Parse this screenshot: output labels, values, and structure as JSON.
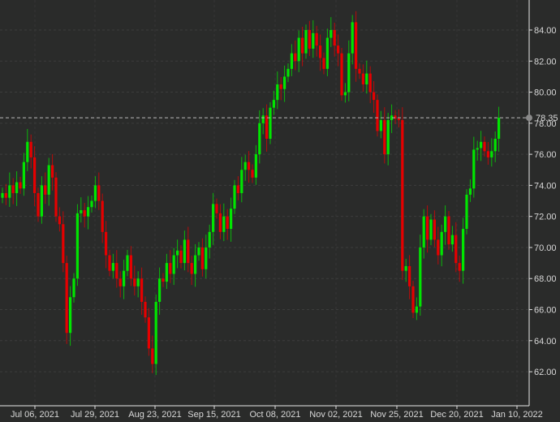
{
  "chart_data": {
    "type": "candlestick",
    "title": "",
    "xlabel": "",
    "ylabel": "",
    "ylim": [
      61,
      85.5
    ],
    "yticks": [
      62,
      64,
      66,
      68,
      70,
      72,
      74,
      76,
      78,
      80,
      82,
      84
    ],
    "ytick_labels": [
      "62.00",
      "64.00",
      "66.00",
      "68.00",
      "70.00",
      "72.00",
      "74.00",
      "76.00",
      "78.00",
      "80.00",
      "82.00",
      "84.00"
    ],
    "xtick_labels": [
      "Jul 06, 2021",
      "Jul 29, 2021",
      "Aug 23, 2021",
      "Sep 15, 2021",
      "Oct 08, 2021",
      "Nov 02, 2021",
      "Nov 25, 2021",
      "Dec 20, 2021",
      "Jan 10, 2022"
    ],
    "xtick_index": [
      9,
      26,
      43,
      59,
      76,
      93,
      110,
      127,
      144
    ],
    "last_price": 78.35,
    "last_price_label": "78.35",
    "up_color": "#00e600",
    "down_color": "#e60000",
    "closes": [
      73.5,
      73.2,
      74,
      73.5,
      74.2,
      73.8,
      75.5,
      76.8,
      75.8,
      73.5,
      72,
      74,
      73.4,
      75.3,
      74.5,
      72,
      71.5,
      69,
      64.5,
      66.8,
      68,
      72.2,
      72.4,
      72,
      72.6,
      73,
      74,
      73,
      71,
      69.5,
      68.5,
      69,
      68,
      67.5,
      68.5,
      69.5,
      68,
      67.5,
      68,
      66.5,
      65.5,
      63.5,
      62.5,
      66.5,
      68,
      67.8,
      69,
      68.3,
      69.5,
      69.8,
      69,
      70.5,
      69,
      68.3,
      69.5,
      70,
      68.6,
      70,
      71,
      72.8,
      72.2,
      71,
      72,
      71.2,
      72.5,
      74,
      73.5,
      75,
      75.5,
      75,
      74.5,
      76,
      78,
      78.5,
      77,
      79,
      79.5,
      80.5,
      80.2,
      81,
      81.5,
      82.5,
      82,
      83.5,
      82.5,
      84,
      82.8,
      83.8,
      83,
      82.2,
      81.5,
      83.5,
      84,
      83,
      82.5,
      79.8,
      80,
      82.5,
      84.5,
      81.5,
      81.2,
      80.5,
      81.2,
      80,
      79.5,
      77.5,
      78.2,
      76,
      78.2,
      78.5,
      78.3,
      78.2,
      68.5,
      68.8,
      67.5,
      65.8,
      66.2,
      70,
      72,
      70.5,
      71.8,
      70.5,
      69.5,
      71,
      72,
      70.2,
      70.8,
      69,
      68.5,
      71.2,
      73.4,
      73.8,
      76.3,
      76.4,
      76.8,
      76.2,
      75.8,
      76.2,
      77,
      78.35
    ]
  }
}
